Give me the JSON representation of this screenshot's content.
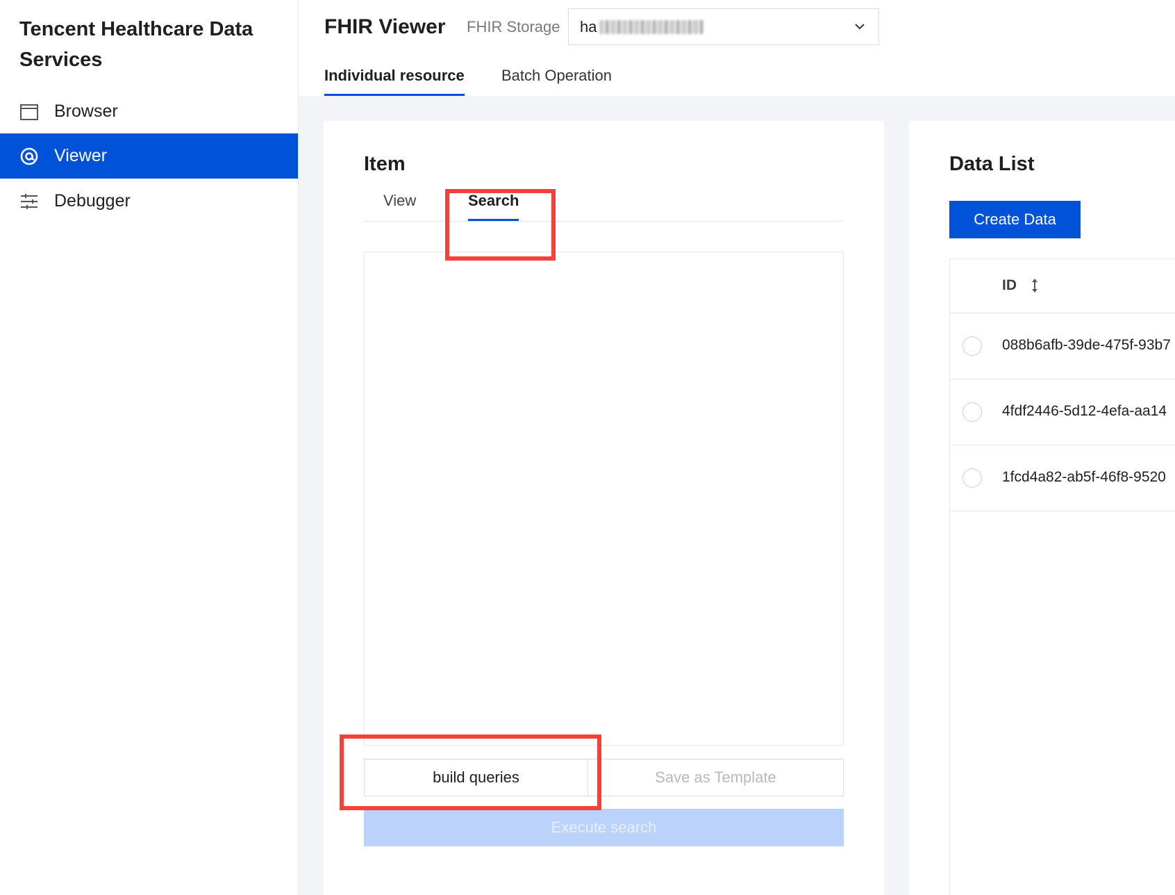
{
  "sidebar": {
    "brand": "Tencent Healthcare Data Services",
    "items": [
      {
        "label": "Browser",
        "icon": "browser-window-icon"
      },
      {
        "label": "Viewer",
        "icon": "at-sign-icon",
        "active": true
      },
      {
        "label": "Debugger",
        "icon": "sliders-icon"
      }
    ],
    "active_color": "#0052d9"
  },
  "header": {
    "title": "FHIR Viewer",
    "storage_label": "FHIR Storage",
    "storage_value_prefix": "ha",
    "tabs": [
      {
        "label": "Individual resource",
        "active": true
      },
      {
        "label": "Batch Operation",
        "active": false
      }
    ]
  },
  "item_panel": {
    "title": "Item",
    "tabs": [
      {
        "label": "View",
        "active": false
      },
      {
        "label": "Search",
        "active": true
      }
    ],
    "build_label": "build queries",
    "save_label": "Save as Template",
    "execute_label": "Execute search"
  },
  "data_list": {
    "title": "Data List",
    "create_label": "Create Data",
    "column_id": "ID",
    "rows": [
      {
        "id": "088b6afb-39de-475f-93b7"
      },
      {
        "id": "4fdf2446-5d12-4efa-aa14"
      },
      {
        "id": "1fcd4a82-ab5f-46f8-9520"
      }
    ]
  },
  "colors": {
    "primary": "#0052d9",
    "highlight": "#f5403b",
    "disabled_button": "#bbd3fb"
  }
}
